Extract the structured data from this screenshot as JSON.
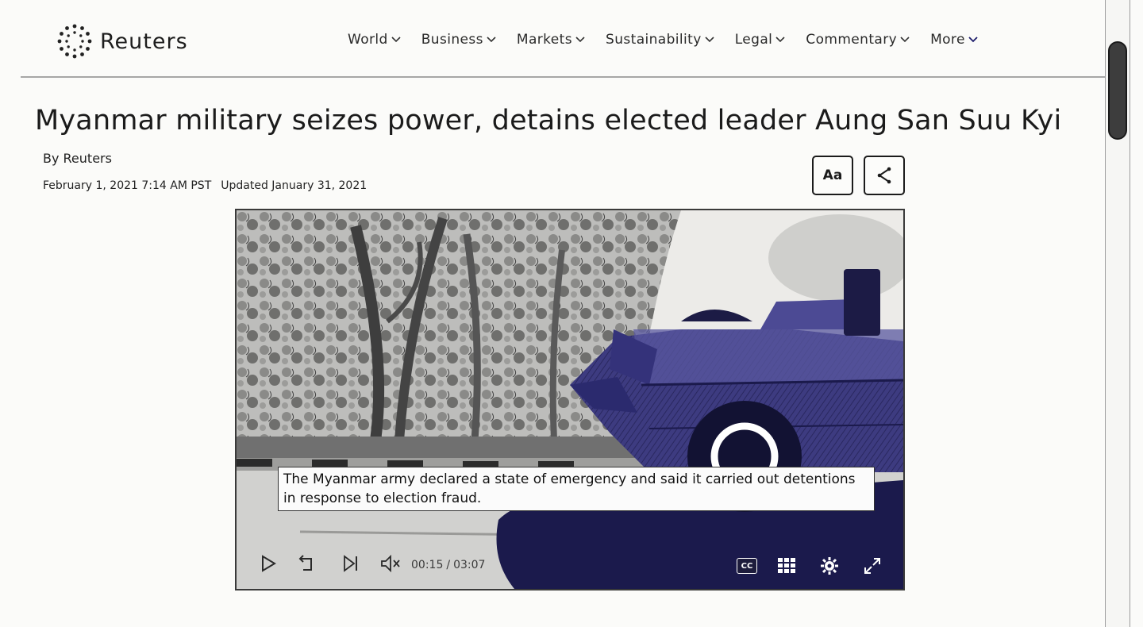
{
  "brand": {
    "name": "Reuters",
    "logo_icon": "reuters-dot-ring-icon"
  },
  "nav": {
    "items": [
      {
        "label": "World"
      },
      {
        "label": "Business"
      },
      {
        "label": "Markets"
      },
      {
        "label": "Sustainability"
      },
      {
        "label": "Legal"
      },
      {
        "label": "Commentary"
      },
      {
        "label": "More"
      }
    ],
    "accent": "#1d1d6b"
  },
  "article": {
    "headline": "Myanmar military seizes power, detains elected leader Aung San Suu Kyi",
    "byline": "By Reuters",
    "published": "February 1, 2021 7:14 AM PST",
    "updated": "Updated January 31, 2021",
    "text_size_label": "Aa",
    "share_icon": "share-icon"
  },
  "video": {
    "caption": "The Myanmar army declared a state of emergency and said it carried out detentions in response to election fraud.",
    "current_time": "00:15",
    "duration": "03:07",
    "cc_label": "CC",
    "icons": [
      "play-icon",
      "replay-icon",
      "skip-next-icon",
      "mute-icon",
      "cc-icon",
      "grid-icon",
      "settings-icon",
      "fullscreen-icon"
    ],
    "colors": {
      "vehicle": "#2b2a6e",
      "shadow": "#1a1a4a"
    }
  }
}
